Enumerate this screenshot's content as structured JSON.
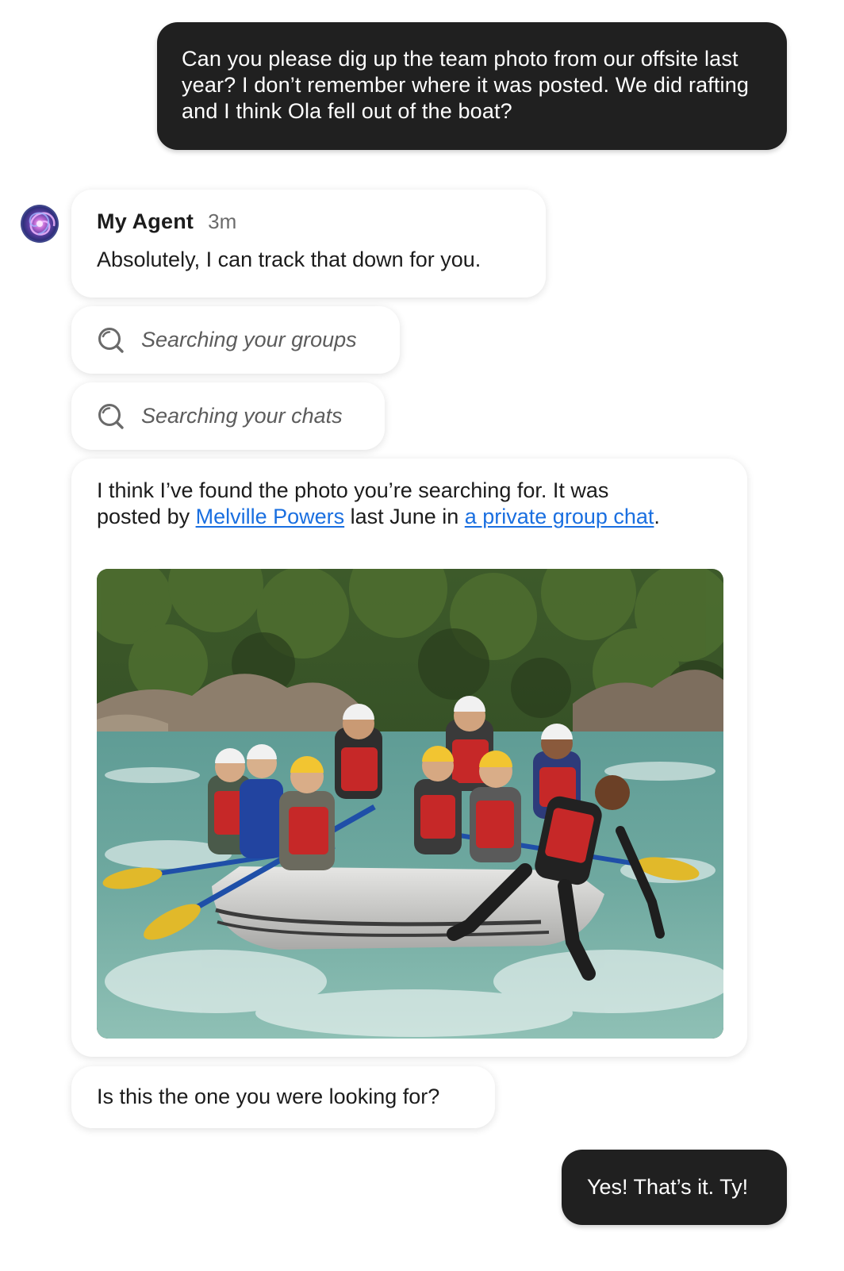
{
  "conversation": {
    "user_message_1": "Can you please dig up the team photo from our offsite last year? I don’t remember where it was posted. We did rafting and I think Ola fell out of the boat?",
    "agent": {
      "name": "My Agent",
      "time": "3m",
      "avatar_icon": "galaxy-avatar"
    },
    "agent_message_1": "Absolutely, I can track that down for you.",
    "status_items": [
      {
        "icon": "search-icon",
        "label": "Searching your groups"
      },
      {
        "icon": "search-icon",
        "label": "Searching your chats"
      }
    ],
    "found": {
      "text_before": "I think I’ve found the photo you’re searching for. It was posted by ",
      "poster_link": "Melville Powers",
      "text_middle": " last June in ",
      "group_link": "a private group chat",
      "text_after": ".",
      "photo_icon": "rafting-team-photo"
    },
    "agent_message_3": "Is this the one you were looking for?",
    "user_message_2": "Yes! That’s it. Ty!"
  },
  "colors": {
    "user_bubble": "#202020",
    "agent_bubble": "#ffffff",
    "link": "#1a6fe0",
    "muted_text": "#6b6b6b"
  }
}
